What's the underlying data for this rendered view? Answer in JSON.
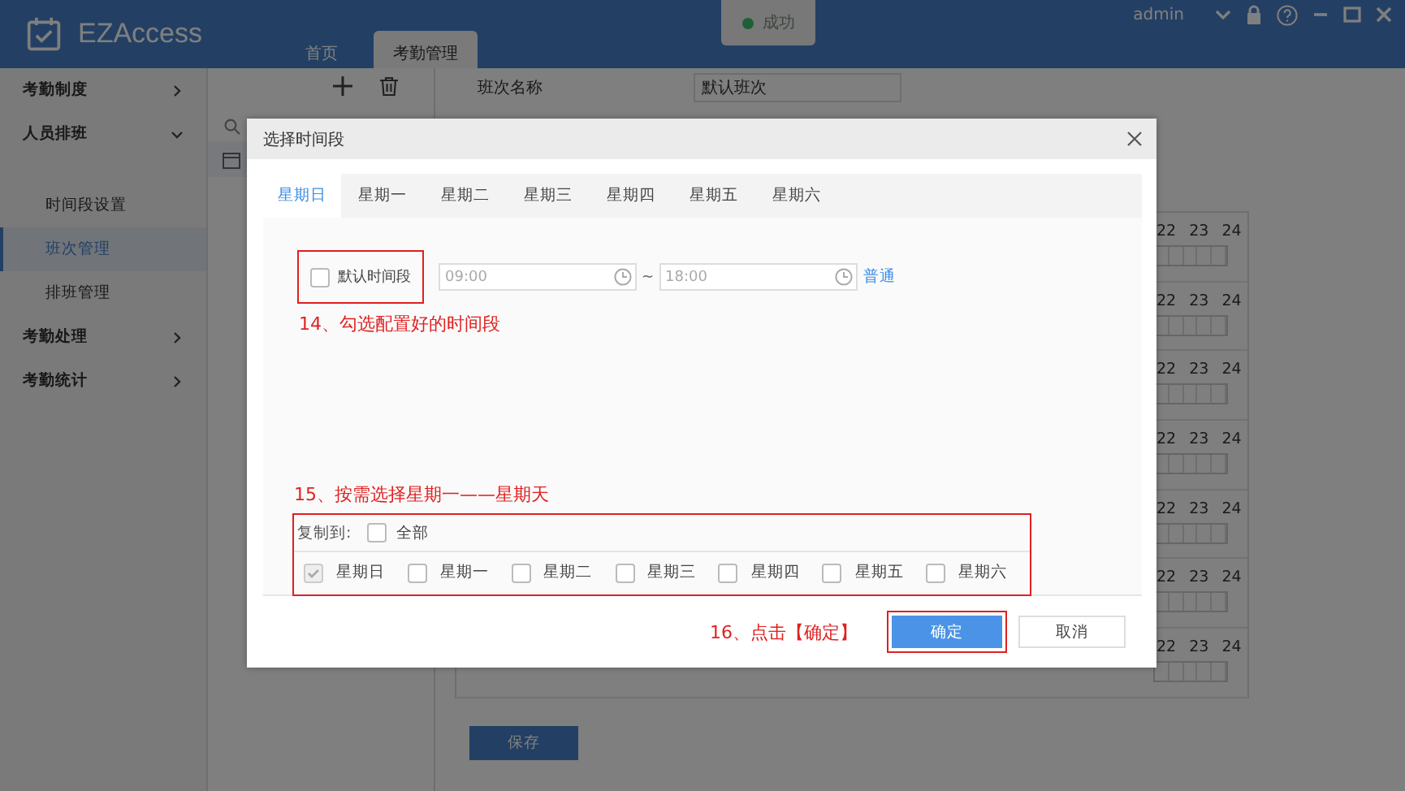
{
  "app": {
    "logo_text": "EZAccess",
    "user": "admin"
  },
  "top_tabs": [
    {
      "label": "首页",
      "selected": false
    },
    {
      "label": "考勤管理",
      "selected": true
    }
  ],
  "toast": {
    "text": "成功"
  },
  "sidebar": {
    "items": [
      {
        "label": "考勤制度",
        "expanded": false
      },
      {
        "label": "人员排班",
        "expanded": true,
        "children": [
          {
            "label": "时间段设置",
            "selected": false
          },
          {
            "label": "班次管理",
            "selected": true
          },
          {
            "label": "排班管理",
            "selected": false
          }
        ]
      },
      {
        "label": "考勤处理",
        "expanded": false
      },
      {
        "label": "考勤统计",
        "expanded": false
      }
    ]
  },
  "shift_form": {
    "name_label": "班次名称",
    "name_value": "默认班次",
    "save": "保存",
    "week_rows": [
      {
        "hours": [
          "22",
          "23",
          "24"
        ]
      },
      {
        "hours": [
          "22",
          "23",
          "24"
        ]
      },
      {
        "hours": [
          "22",
          "23",
          "24"
        ]
      },
      {
        "hours": [
          "22",
          "23",
          "24"
        ]
      },
      {
        "hours": [
          "22",
          "23",
          "24"
        ]
      },
      {
        "hours": [
          "22",
          "23",
          "24"
        ]
      },
      {
        "hours": [
          "22",
          "23",
          "24"
        ]
      }
    ]
  },
  "dialog": {
    "title": "选择时间段",
    "tabs": [
      {
        "label": "星期日",
        "selected": true
      },
      {
        "label": "星期一",
        "selected": false
      },
      {
        "label": "星期二",
        "selected": false
      },
      {
        "label": "星期三",
        "selected": false
      },
      {
        "label": "星期四",
        "selected": false
      },
      {
        "label": "星期五",
        "selected": false
      },
      {
        "label": "星期六",
        "selected": false
      }
    ],
    "periods": [
      {
        "label": "默认时间段",
        "checked": false,
        "start": {
          "placeholder": "09:00"
        },
        "separator": "~",
        "end": {
          "placeholder": "18:00"
        },
        "type": "普通"
      }
    ],
    "period_note": "14、勾选配置好的时间段",
    "copy_note": "15、按需选择星期一——星期天",
    "copy_to": {
      "label": "复制到:",
      "all": {
        "label": "全部",
        "checked": false
      },
      "days": [
        {
          "label": "星期日",
          "checked": true,
          "disabled": true
        },
        {
          "label": "星期一",
          "checked": false,
          "disabled": false
        },
        {
          "label": "星期二",
          "checked": false,
          "disabled": false
        },
        {
          "label": "星期三",
          "checked": false,
          "disabled": false
        },
        {
          "label": "星期四",
          "checked": false,
          "disabled": false
        },
        {
          "label": "星期五",
          "checked": false,
          "disabled": false
        },
        {
          "label": "星期六",
          "checked": false,
          "disabled": false
        }
      ]
    },
    "confirm_note": "16、点击【确定】",
    "buttons": [
      {
        "label": "确定",
        "kind": "primary"
      },
      {
        "label": "取消",
        "kind": "default"
      }
    ]
  }
}
